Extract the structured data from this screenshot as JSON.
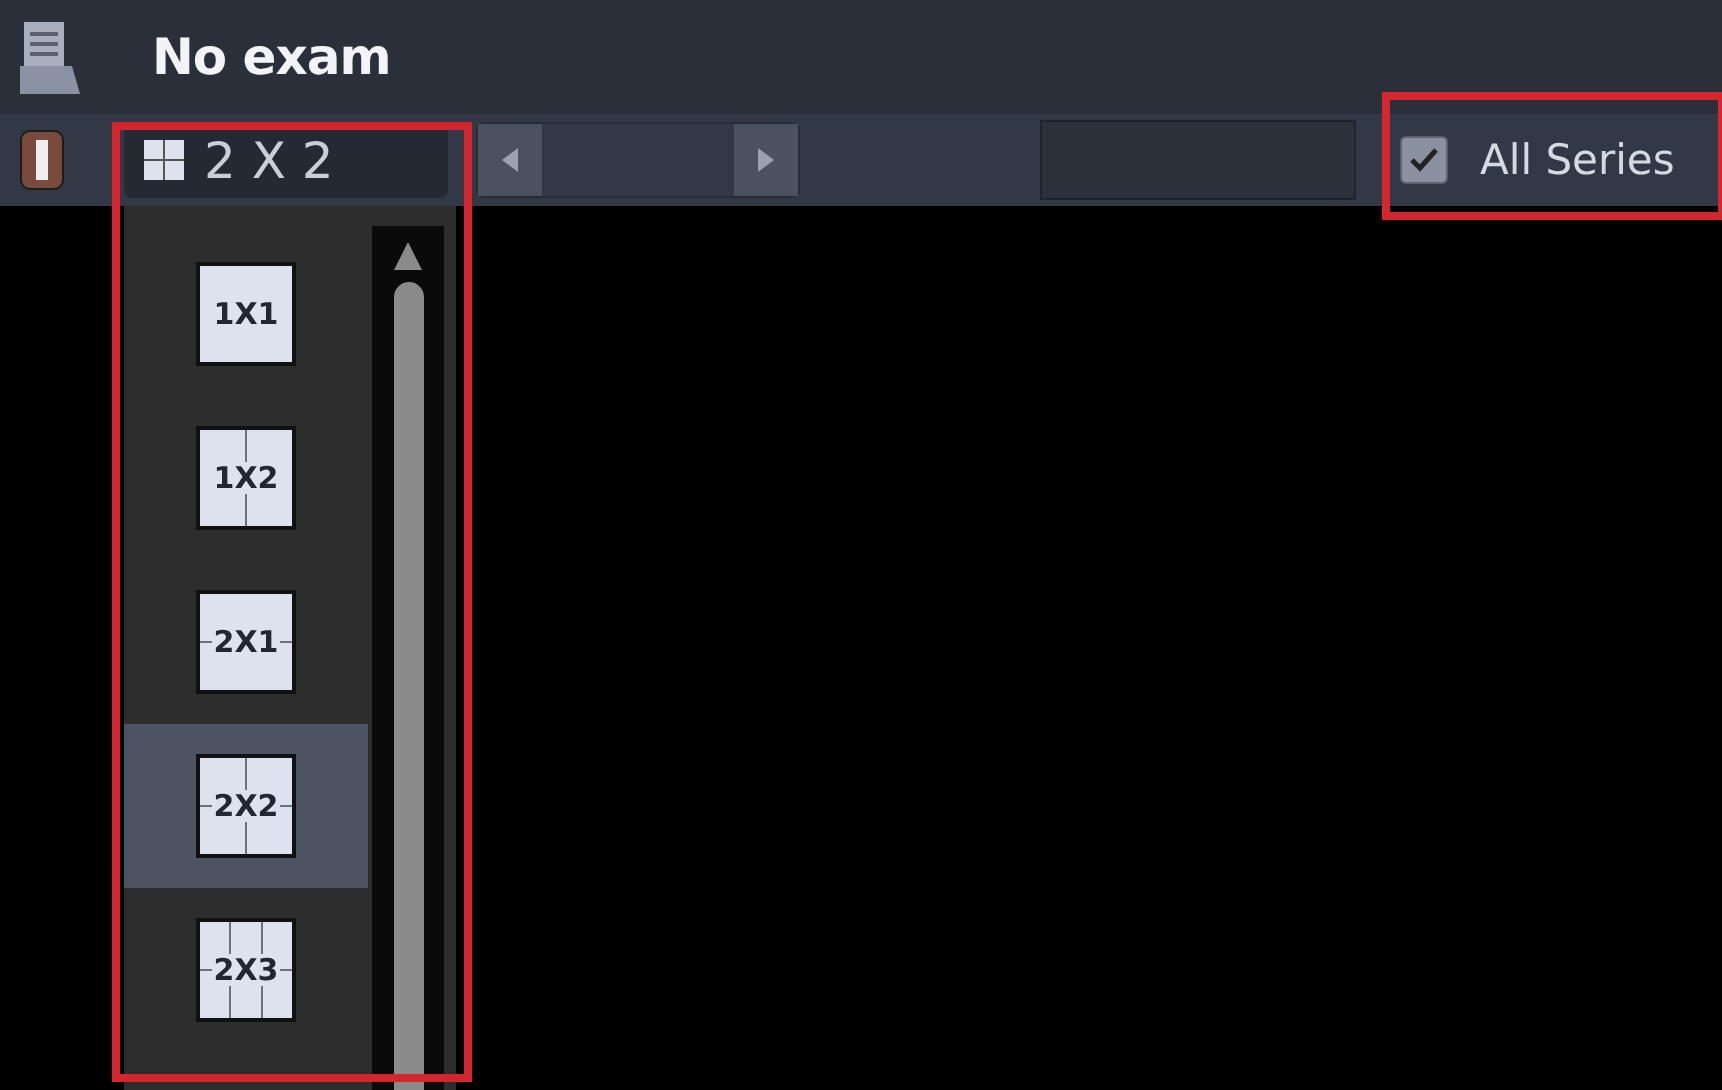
{
  "header": {
    "title": "No exam"
  },
  "toolbar": {
    "layout_select": {
      "value": "2 X 2"
    },
    "all_series": {
      "label": "All Series",
      "checked": true
    }
  },
  "layout_menu": [
    {
      "label": "1X1",
      "kind": "single",
      "selected": false
    },
    {
      "label": "1X2",
      "kind": "columns",
      "selected": false
    },
    {
      "label": "2X1",
      "kind": "rows",
      "selected": false
    },
    {
      "label": "2X2",
      "kind": "quad",
      "selected": true
    },
    {
      "label": "2X3",
      "kind": "six",
      "selected": false
    }
  ]
}
